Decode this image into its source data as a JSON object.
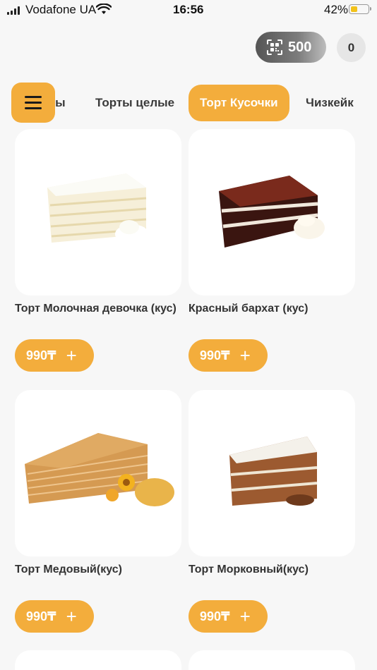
{
  "status_bar": {
    "carrier": "Vodafone UA",
    "time": "16:56",
    "battery_percent": "42%",
    "battery_level": 0.42,
    "icons": [
      "signal-icon",
      "wifi-icon",
      "battery-icon"
    ]
  },
  "header": {
    "points": "500",
    "points_icon": "qr-code-icon",
    "cart_count": "0"
  },
  "tabs": [
    {
      "label": "Торты"
    },
    {
      "label": "Торты целые"
    },
    {
      "label": "Торт Кусочки",
      "active": true
    },
    {
      "label": "Чизкейк"
    }
  ],
  "products": [
    {
      "name": " Торт Молочная девочка (кус)",
      "price": "990₸",
      "add": "+"
    },
    {
      "name": "Красный бархат (кус)",
      "price": "990₸",
      "add": "+"
    },
    {
      "name": "Торт Медовый(кус)",
      "price": "990₸",
      "add": "+"
    },
    {
      "name": "Торт Морковный(кус)",
      "price": "990₸",
      "add": "+"
    }
  ],
  "colors": {
    "accent": "#f3ad3c",
    "background": "#f7f7f7",
    "card": "#ffffff"
  }
}
